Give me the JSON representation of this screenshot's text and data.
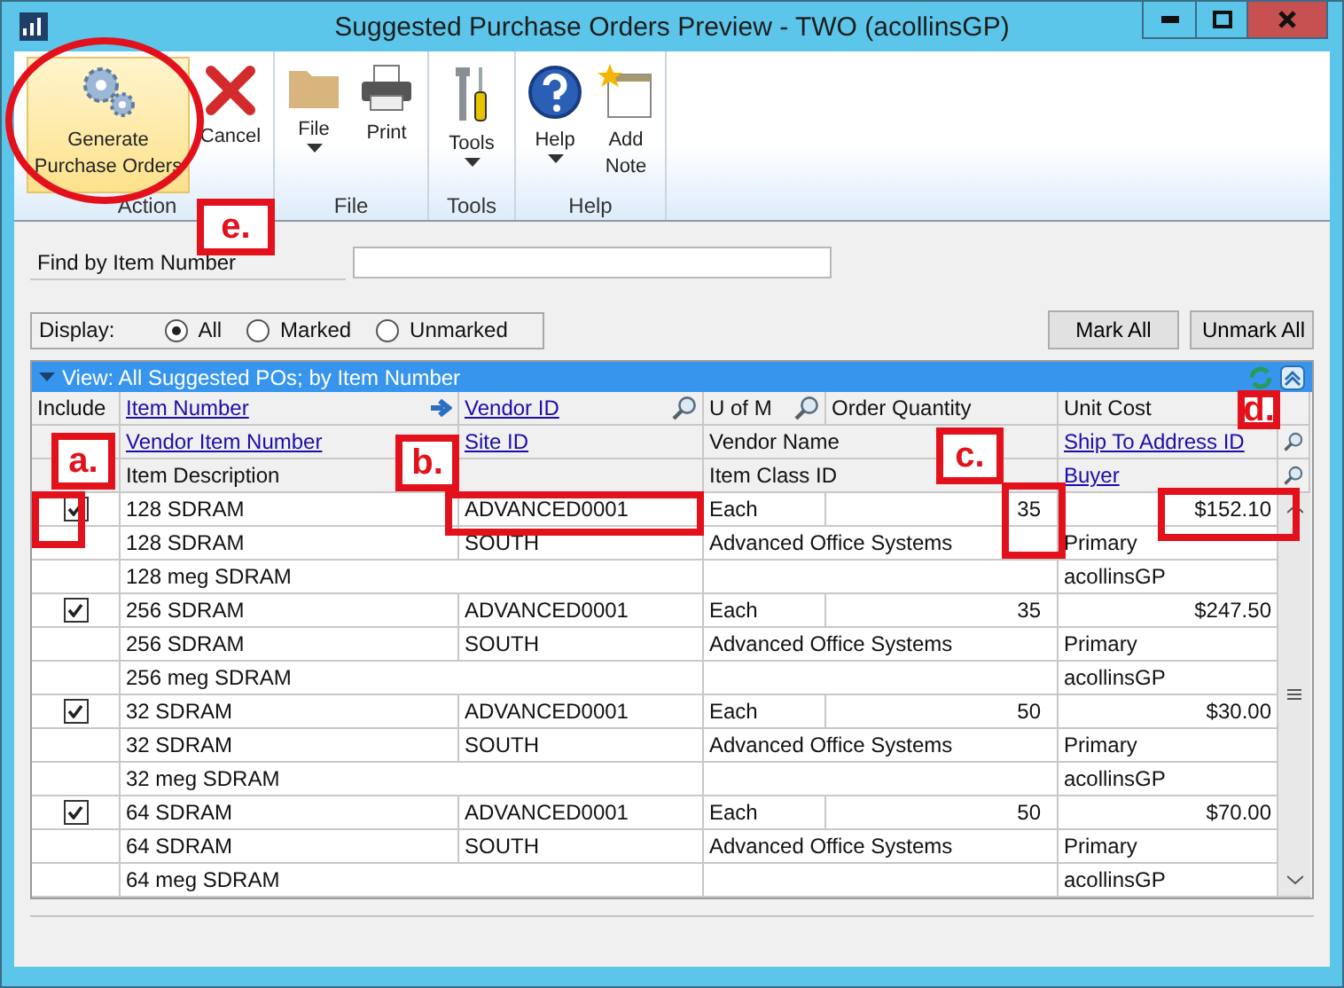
{
  "window": {
    "title": "Suggested Purchase Orders Preview  -  TWO (acollinsGP)"
  },
  "ribbon": {
    "groups": [
      {
        "label": "Action",
        "buttons": [
          {
            "label": "Generate Purchase Orders",
            "highlighted": true,
            "dropdown": false
          },
          {
            "label": "Cancel",
            "highlighted": false,
            "dropdown": false
          }
        ]
      },
      {
        "label": "File",
        "buttons": [
          {
            "label": "File",
            "highlighted": false,
            "dropdown": true
          },
          {
            "label": "Print",
            "highlighted": false,
            "dropdown": false
          }
        ]
      },
      {
        "label": "Tools",
        "buttons": [
          {
            "label": "Tools",
            "highlighted": false,
            "dropdown": true
          }
        ]
      },
      {
        "label": "Help",
        "buttons": [
          {
            "label": "Help",
            "highlighted": false,
            "dropdown": true
          },
          {
            "label": "Add Note",
            "highlighted": false,
            "dropdown": false
          }
        ]
      }
    ]
  },
  "find": {
    "label": "Find by Item Number"
  },
  "display": {
    "label": "Display:",
    "options": [
      {
        "label": "All",
        "selected": true
      },
      {
        "label": "Marked",
        "selected": false
      },
      {
        "label": "Unmarked",
        "selected": false
      }
    ]
  },
  "buttons": [
    "Mark All",
    "Unmark All"
  ],
  "grid": {
    "view": "View: All Suggested POs; by Item Number",
    "header": {
      "include": "Include",
      "item_number": "Item Number",
      "vendor_id": "Vendor ID",
      "u_of_m": "U of M",
      "order_quantity": "Order Quantity",
      "unit_cost": "Unit Cost",
      "vendor_item_number": "Vendor Item Number",
      "site_id": "Site ID",
      "vendor_name": "Vendor Name",
      "ship_to": "Ship To Address ID",
      "description": "Item Description",
      "item_class": "Item Class ID",
      "buyer": "Buyer"
    },
    "items": [
      {
        "include": true,
        "item_number": "128 SDRAM",
        "vendor_id": "ADVANCED0001",
        "u_of_m": "Each",
        "order_quantity": "35",
        "unit_cost": "$152.10",
        "vendor_item_number": "128 SDRAM",
        "site_id": "SOUTH",
        "vendor_name": "Advanced Office Systems",
        "ship_to": "Primary",
        "description": "128 meg SDRAM",
        "buyer": "acollinsGP"
      },
      {
        "include": true,
        "item_number": "256 SDRAM",
        "vendor_id": "ADVANCED0001",
        "u_of_m": "Each",
        "order_quantity": "35",
        "unit_cost": "$247.50",
        "vendor_item_number": "256 SDRAM",
        "site_id": "SOUTH",
        "vendor_name": "Advanced Office Systems",
        "ship_to": "Primary",
        "description": "256 meg SDRAM",
        "buyer": "acollinsGP"
      },
      {
        "include": true,
        "item_number": "32 SDRAM",
        "vendor_id": "ADVANCED0001",
        "u_of_m": "Each",
        "order_quantity": "50",
        "unit_cost": "$30.00",
        "vendor_item_number": "32 SDRAM",
        "site_id": "SOUTH",
        "vendor_name": "Advanced Office Systems",
        "ship_to": "Primary",
        "description": "32 meg SDRAM",
        "buyer": "acollinsGP"
      },
      {
        "include": true,
        "item_number": "64 SDRAM",
        "vendor_id": "ADVANCED0001",
        "u_of_m": "Each",
        "order_quantity": "50",
        "unit_cost": "$70.00",
        "vendor_item_number": "64 SDRAM",
        "site_id": "SOUTH",
        "vendor_name": "Advanced Office Systems",
        "ship_to": "Primary",
        "description": "64 meg SDRAM",
        "buyer": "acollinsGP"
      }
    ]
  },
  "callouts": [
    {
      "label": "e."
    },
    {
      "label": "a."
    },
    {
      "label": "b."
    },
    {
      "label": "c."
    },
    {
      "label": "d."
    }
  ]
}
